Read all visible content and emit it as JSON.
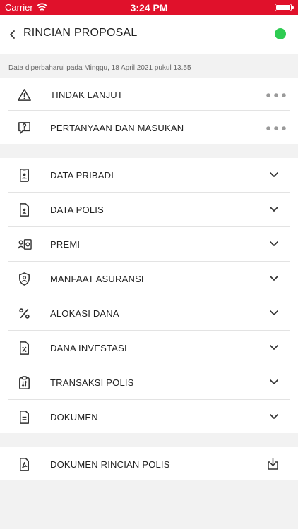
{
  "status_bar": {
    "carrier": "Carrier",
    "time": "3:24 PM"
  },
  "header": {
    "title": "RINCIAN PROPOSAL",
    "status_color": "#2ecc52"
  },
  "updated_text": "Data diperbaharui pada Minggu, 18 April 2021 pukul 13.55",
  "colors": {
    "brand": "#e0112b",
    "status_green": "#2ecc52"
  },
  "action_items": [
    {
      "label": "TINDAK LANJUT",
      "icon": "warning-icon"
    },
    {
      "label": "PERTANYAAN DAN MASUKAN",
      "icon": "question-bubble-icon"
    }
  ],
  "sections": [
    {
      "label": "DATA PRIBADI",
      "icon": "id-card-icon"
    },
    {
      "label": "DATA POLIS",
      "icon": "policy-document-icon"
    },
    {
      "label": "PREMI",
      "icon": "premium-icon"
    },
    {
      "label": "MANFAAT ASURANSI",
      "icon": "shield-person-icon"
    },
    {
      "label": "ALOKASI DANA",
      "icon": "percent-icon"
    },
    {
      "label": "DANA INVESTASI",
      "icon": "investment-document-icon"
    },
    {
      "label": "TRANSAKSI POLIS",
      "icon": "clipboard-transaction-icon"
    },
    {
      "label": "DOKUMEN",
      "icon": "document-icon"
    }
  ],
  "download": {
    "label": "DOKUMEN RINCIAN POLIS",
    "icon": "pdf-icon",
    "action_icon": "download-icon"
  }
}
